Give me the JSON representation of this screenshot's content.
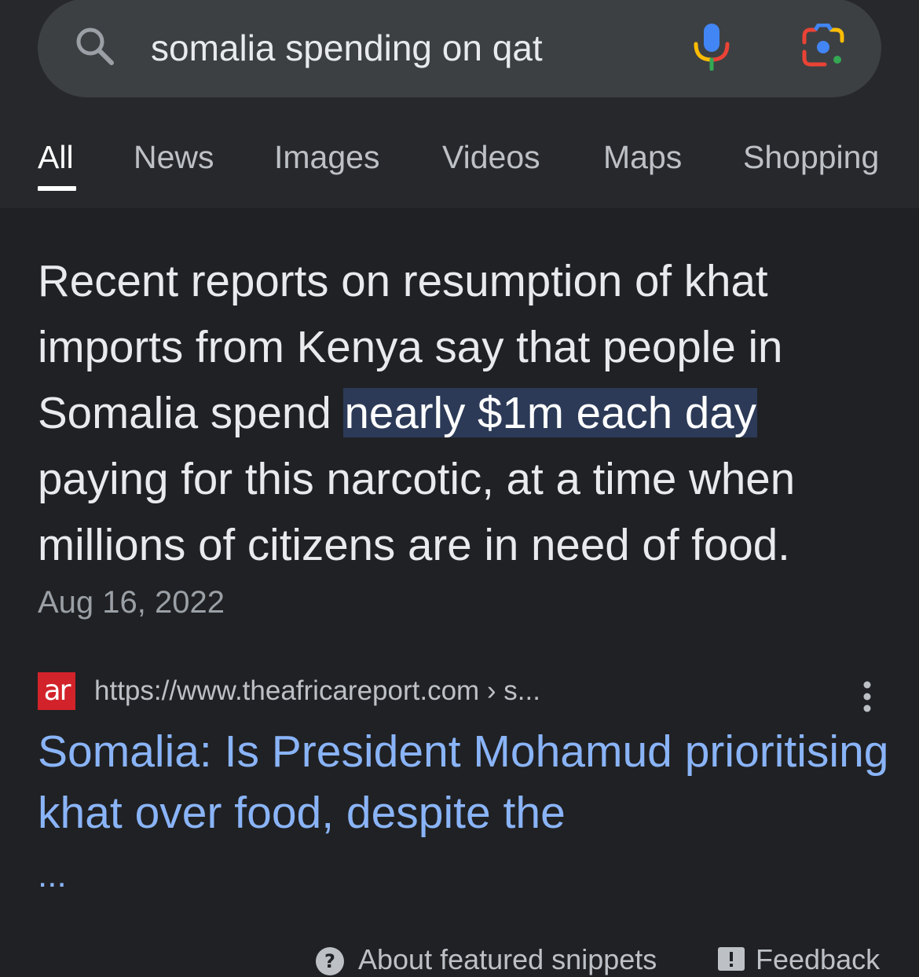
{
  "search": {
    "query": "somalia spending on qat"
  },
  "icons": {
    "search": "search-icon",
    "mic": "microphone-icon",
    "lens": "google-lens-icon",
    "more": "more-vertical-icon",
    "help": "help-circle-icon",
    "feedback": "feedback-icon"
  },
  "tabs": [
    {
      "label": "All",
      "active": true
    },
    {
      "label": "News",
      "active": false
    },
    {
      "label": "Images",
      "active": false
    },
    {
      "label": "Videos",
      "active": false
    },
    {
      "label": "Maps",
      "active": false
    },
    {
      "label": "Shopping",
      "active": false
    }
  ],
  "featured_snippet": {
    "text_before": "Recent reports on resumption of khat imports from Kenya say that people in Somalia spend ",
    "highlight": "nearly $1m each day",
    "text_after": " paying for this narcotic, at a time when millions of citizens are in need of food.",
    "date": "Aug 16, 2022"
  },
  "source": {
    "favicon_text": "ar",
    "url": "https://www.theafricareport.com › s...",
    "title": "Somalia: Is President Mohamud prioritising khat over food, despite the",
    "title_ellipsis": "..."
  },
  "footer": {
    "about_label": "About featured snippets",
    "feedback_label": "Feedback"
  },
  "colors": {
    "background": "#202124",
    "link": "#8ab4f8",
    "highlight": "#2c3a57",
    "favicon": "#d2232a"
  }
}
